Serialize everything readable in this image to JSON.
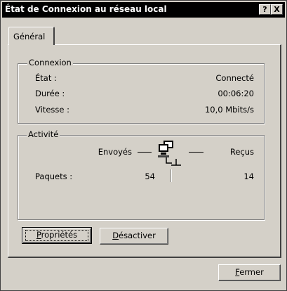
{
  "window": {
    "title": "État de Connexion au réseau local",
    "help_label": "?",
    "close_label": "X"
  },
  "tabs": [
    {
      "label": "Général",
      "selected": true
    }
  ],
  "connexion": {
    "group_title": "Connexion",
    "rows": [
      {
        "label": "État :",
        "value": "Connecté"
      },
      {
        "label": "Durée :",
        "value": "00:06:20"
      },
      {
        "label": "Vitesse :",
        "value": "10,0 Mbits/s"
      }
    ]
  },
  "activite": {
    "group_title": "Activité",
    "sent_label": "Envoyés",
    "received_label": "Reçus",
    "packets_label": "Paquets :",
    "packets_sent": "54",
    "packets_received": "14",
    "icon": "network-computers-icon"
  },
  "buttons": {
    "properties": {
      "first": "P",
      "rest": "ropriétés"
    },
    "disable": {
      "first": "D",
      "rest": "ésactiver"
    },
    "close": {
      "first": "F",
      "rest": "ermer"
    }
  }
}
